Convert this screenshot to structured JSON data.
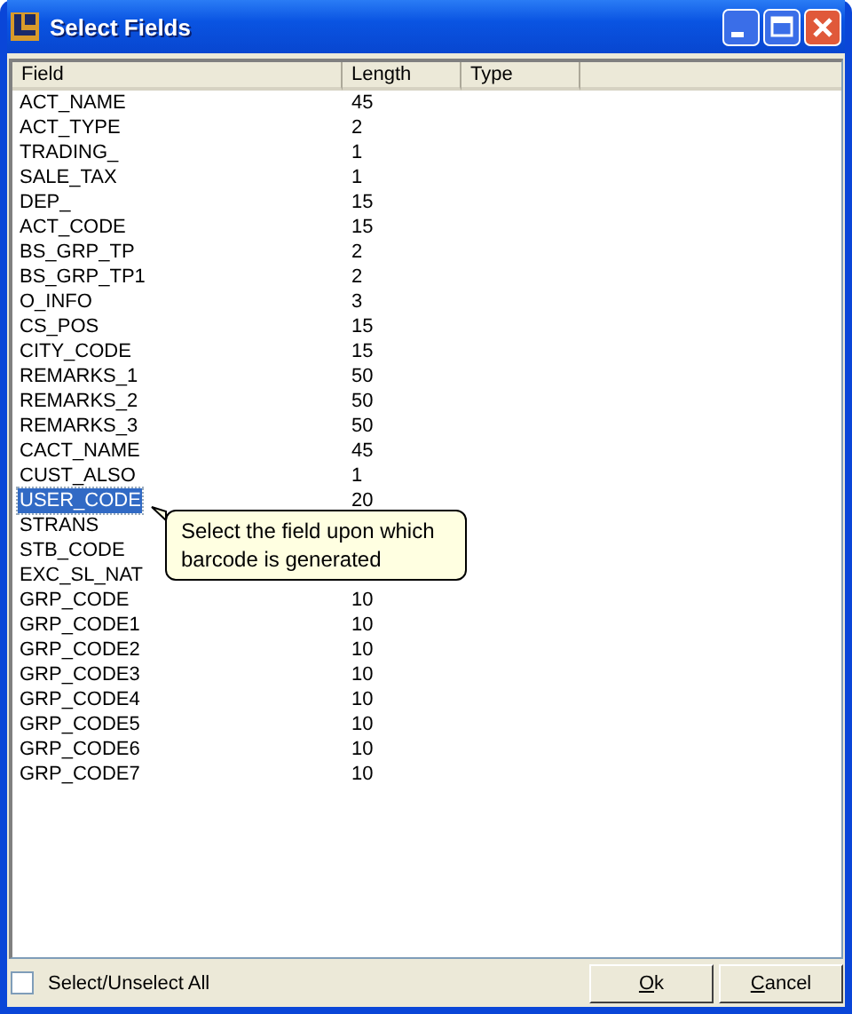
{
  "window": {
    "title": "Select Fields"
  },
  "columns": [
    "Field",
    "Length",
    "Type"
  ],
  "rows": [
    {
      "field": "ACT_NAME",
      "length": "45",
      "selected": false
    },
    {
      "field": "ACT_TYPE",
      "length": "2",
      "selected": false
    },
    {
      "field": "TRADING_",
      "length": "1",
      "selected": false
    },
    {
      "field": "SALE_TAX",
      "length": "1",
      "selected": false
    },
    {
      "field": "DEP_",
      "length": "15",
      "selected": false
    },
    {
      "field": "ACT_CODE",
      "length": "15",
      "selected": false
    },
    {
      "field": "BS_GRP_TP",
      "length": "2",
      "selected": false
    },
    {
      "field": "BS_GRP_TP1",
      "length": "2",
      "selected": false
    },
    {
      "field": "O_INFO",
      "length": "3",
      "selected": false
    },
    {
      "field": "CS_POS",
      "length": "15",
      "selected": false
    },
    {
      "field": "CITY_CODE",
      "length": "15",
      "selected": false
    },
    {
      "field": "REMARKS_1",
      "length": "50",
      "selected": false
    },
    {
      "field": "REMARKS_2",
      "length": "50",
      "selected": false
    },
    {
      "field": "REMARKS_3",
      "length": "50",
      "selected": false
    },
    {
      "field": "CACT_NAME",
      "length": "45",
      "selected": false
    },
    {
      "field": "CUST_ALSO",
      "length": "1",
      "selected": false
    },
    {
      "field": "USER_CODE",
      "length": "20",
      "selected": true
    },
    {
      "field": "STRANS",
      "selected": false
    },
    {
      "field": "STB_CODE",
      "selected": false
    },
    {
      "field": "EXC_SL_NAT",
      "selected": false
    },
    {
      "field": "GRP_CODE",
      "length": "10",
      "selected": false
    },
    {
      "field": "GRP_CODE1",
      "length": "10",
      "selected": false
    },
    {
      "field": "GRP_CODE2",
      "length": "10",
      "selected": false
    },
    {
      "field": "GRP_CODE3",
      "length": "10",
      "selected": false
    },
    {
      "field": "GRP_CODE4",
      "length": "10",
      "selected": false
    },
    {
      "field": "GRP_CODE5",
      "length": "10",
      "selected": false
    },
    {
      "field": "GRP_CODE6",
      "length": "10",
      "selected": false
    },
    {
      "field": "GRP_CODE7",
      "length": "10",
      "selected": false
    }
  ],
  "tooltip": "Select the field upon which barcode is generated",
  "select_all": {
    "label": "Select/Unselect All",
    "checked": false
  },
  "buttons": [
    "Ok",
    "Cancel"
  ]
}
